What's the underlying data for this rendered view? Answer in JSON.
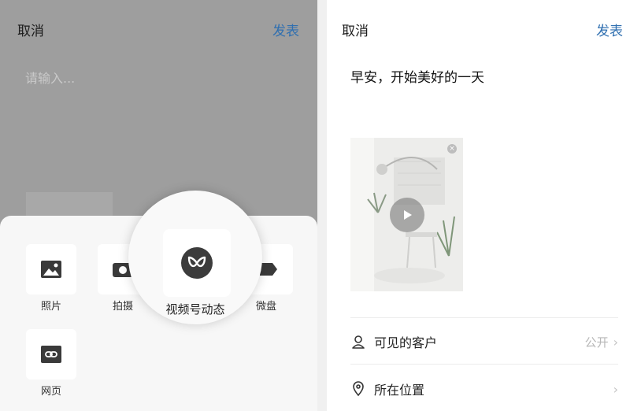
{
  "left_screen": {
    "cancel_label": "取消",
    "publish_label": "发表",
    "input_placeholder": "请输入...",
    "sheet_items": [
      {
        "label": "照片",
        "icon": "image-icon"
      },
      {
        "label": "拍摄",
        "icon": "camera-icon"
      },
      {
        "label": "视频号动态",
        "icon": "channels-icon"
      },
      {
        "label": "微盘",
        "icon": "drive-icon"
      },
      {
        "label": "网页",
        "icon": "link-icon"
      }
    ]
  },
  "right_screen": {
    "cancel_label": "取消",
    "publish_label": "发表",
    "post_text": "早安，开始美好的一天",
    "video_thumbnail": {
      "icon": "play-icon",
      "close_icon": "close-icon"
    },
    "rows": [
      {
        "label": "可见的客户",
        "value": "公开",
        "icon": "person-icon"
      },
      {
        "label": "所在位置",
        "value": "",
        "icon": "location-icon"
      }
    ]
  },
  "colors": {
    "accent": "#2f6fb0",
    "overlay": "#9e9e9e"
  }
}
